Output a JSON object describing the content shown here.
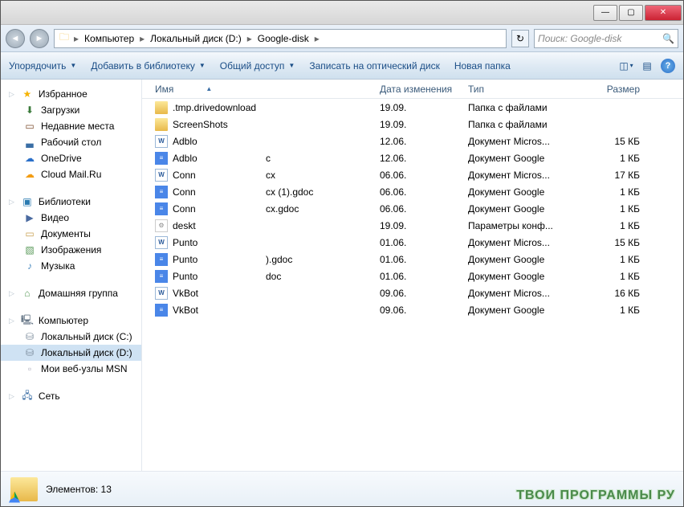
{
  "titlebar": {
    "min": "—",
    "max": "▢",
    "close": "✕"
  },
  "breadcrumb": [
    "Компьютер",
    "Локальный диск (D:)",
    "Google-disk"
  ],
  "search": {
    "placeholder": "Поиск: Google-disk"
  },
  "toolbar": {
    "organize": "Упорядочить",
    "library": "Добавить в библиотеку",
    "share": "Общий доступ",
    "burn": "Записать на оптический диск",
    "newfolder": "Новая папка"
  },
  "columns": {
    "name": "Имя",
    "date": "Дата изменения",
    "type": "Тип",
    "size": "Размер"
  },
  "sidebar": {
    "favorites": "Избранное",
    "fav_items": [
      {
        "icon": "dl",
        "label": "Загрузки"
      },
      {
        "icon": "recent",
        "label": "Недавние места"
      },
      {
        "icon": "desk",
        "label": "Рабочий стол"
      },
      {
        "icon": "onedrive",
        "label": "OneDrive"
      },
      {
        "icon": "mail",
        "label": "Cloud Mail.Ru"
      }
    ],
    "libraries": "Библиотеки",
    "lib_items": [
      {
        "icon": "vid",
        "label": "Видео"
      },
      {
        "icon": "doc",
        "label": "Документы"
      },
      {
        "icon": "img",
        "label": "Изображения"
      },
      {
        "icon": "mus",
        "label": "Музыка"
      }
    ],
    "homegroup": "Домашняя группа",
    "computer": "Компьютер",
    "comp_items": [
      {
        "icon": "disk",
        "label": "Локальный диск (C:)",
        "sel": false
      },
      {
        "icon": "disk",
        "label": "Локальный диск (D:)",
        "sel": true
      },
      {
        "icon": "page",
        "label": "Мои веб-узлы MSN",
        "sel": false
      }
    ],
    "network": "Сеть"
  },
  "files": [
    {
      "icon": "folder",
      "name": ".tmp.drivedownload",
      "name2": "",
      "date": "19.09.",
      "type": "Папка с файлами",
      "size": ""
    },
    {
      "icon": "folder",
      "name": "ScreenShots",
      "name2": "",
      "date": "19.09.",
      "type": "Папка с файлами",
      "size": ""
    },
    {
      "icon": "word",
      "name": "Adblo",
      "name2": "",
      "date": "12.06.",
      "type": "Документ Micros...",
      "size": "15 КБ"
    },
    {
      "icon": "gdoc",
      "name": "Adblo",
      "name2": "c",
      "date": "12.06.",
      "type": "Документ Google",
      "size": "1 КБ"
    },
    {
      "icon": "word",
      "name": "Conn",
      "name2": "cx",
      "date": "06.06.",
      "type": "Документ Micros...",
      "size": "17 КБ"
    },
    {
      "icon": "gdoc",
      "name": "Conn",
      "name2": "cx (1).gdoc",
      "date": "06.06.",
      "type": "Документ Google",
      "size": "1 КБ"
    },
    {
      "icon": "gdoc",
      "name": "Conn",
      "name2": "cx.gdoc",
      "date": "06.06.",
      "type": "Документ Google",
      "size": "1 КБ"
    },
    {
      "icon": "ini",
      "name": "deskt",
      "name2": "",
      "date": "19.09.",
      "type": "Параметры конф...",
      "size": "1 КБ"
    },
    {
      "icon": "word",
      "name": "Punto",
      "name2": "",
      "date": "01.06.",
      "type": "Документ Micros...",
      "size": "15 КБ"
    },
    {
      "icon": "gdoc",
      "name": "Punto",
      "name2": ").gdoc",
      "date": "01.06.",
      "type": "Документ Google",
      "size": "1 КБ"
    },
    {
      "icon": "gdoc",
      "name": "Punto",
      "name2": "doc",
      "date": "01.06.",
      "type": "Документ Google",
      "size": "1 КБ"
    },
    {
      "icon": "word",
      "name": "VkBot",
      "name2": "",
      "date": "09.06.",
      "type": "Документ Micros...",
      "size": "16 КБ"
    },
    {
      "icon": "gdoc",
      "name": "VkBot",
      "name2": "",
      "date": "09.06.",
      "type": "Документ Google",
      "size": "1 КБ"
    }
  ],
  "status": {
    "count": "Элементов: 13"
  },
  "watermark": "ТВОИ ПРОГРАММЫ РУ"
}
